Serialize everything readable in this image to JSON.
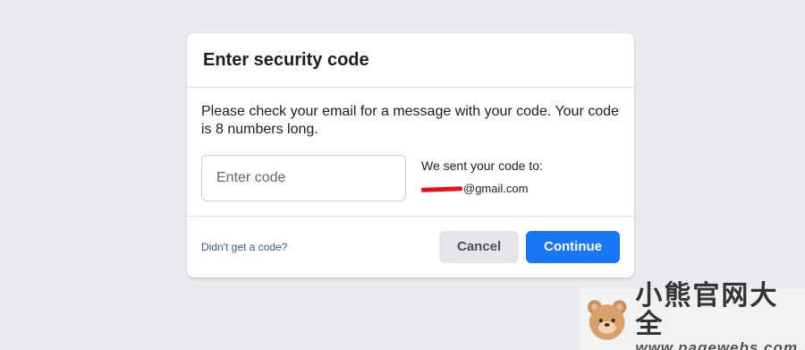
{
  "dialog": {
    "title": "Enter security code",
    "instructions": "Please check your email for a message with your code. Your code is 8 numbers long.",
    "code_input": {
      "placeholder": "Enter code",
      "value": ""
    },
    "sent_label": "We sent your code to:",
    "sent_email_suffix": "@gmail.com",
    "resend_link": "Didn't get a code?",
    "cancel_label": "Cancel",
    "continue_label": "Continue"
  },
  "watermark": {
    "brand": "小熊官网大全",
    "url": "www.pagewebs.com"
  },
  "colors": {
    "background": "#e9ebee",
    "primary": "#1877f2",
    "link": "#385898",
    "redaction": "#e8121b"
  }
}
